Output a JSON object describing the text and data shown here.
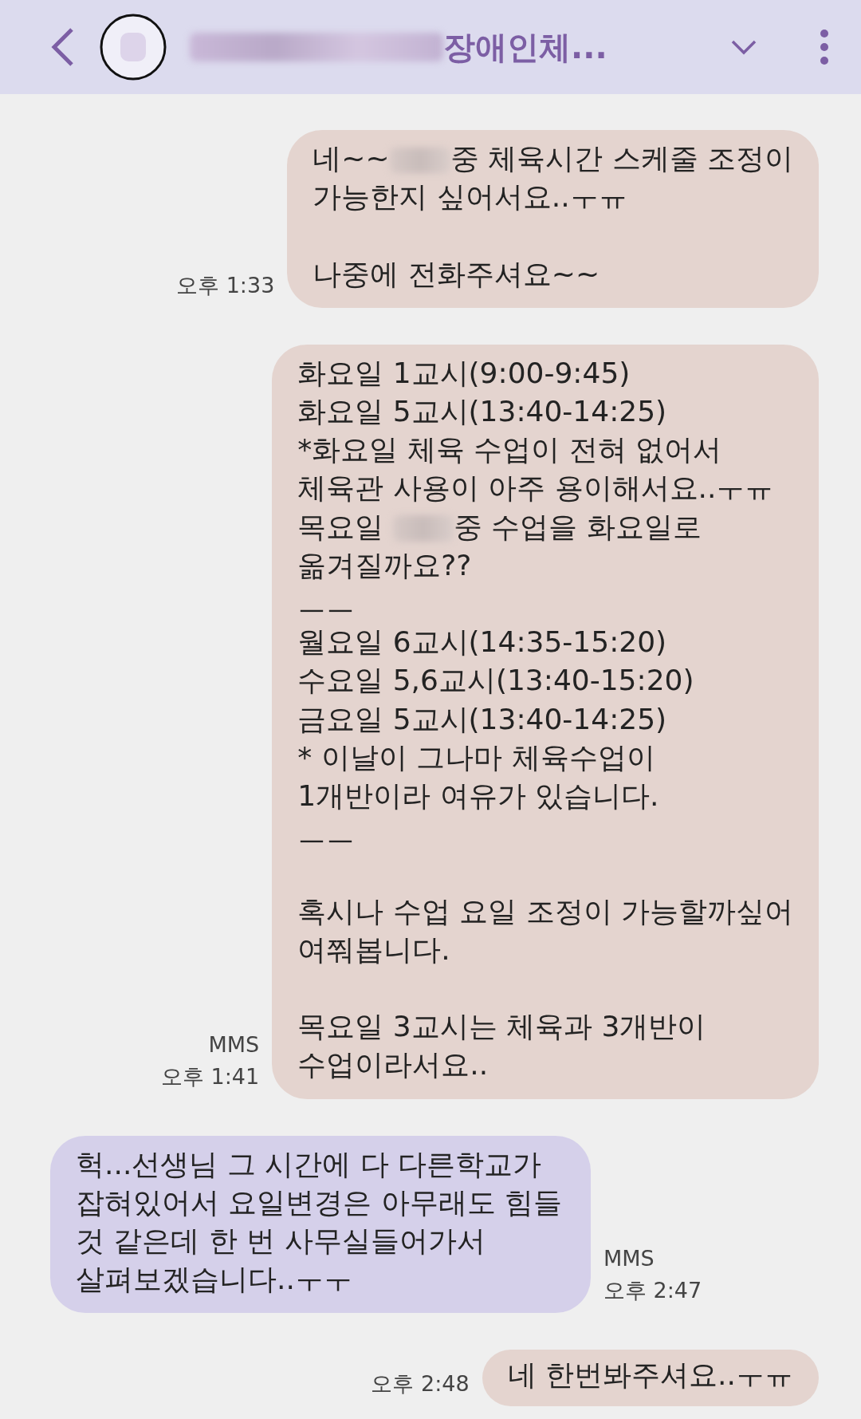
{
  "header": {
    "title": [
      {
        "kind": "redacted"
      },
      {
        "kind": "text",
        "text": "장애인체..."
      }
    ]
  },
  "messages": [
    {
      "kind": "sent",
      "time": "오후 1:33",
      "lines": [
        [
          {
            "kind": "text",
            "text": "네~~"
          },
          {
            "kind": "redacted"
          },
          {
            "kind": "text",
            "text": "중 체육시간 스케줄 조정이"
          }
        ],
        [
          {
            "kind": "text",
            "text": "가능한지 싶어서요..ㅜㅠ"
          }
        ],
        [
          {
            "kind": "blank"
          }
        ],
        [
          {
            "kind": "text",
            "text": "나중에 전화주셔요~~"
          }
        ]
      ]
    },
    {
      "kind": "sent",
      "meta": [
        "MMS"
      ],
      "time": "오후 1:41",
      "lines": [
        [
          {
            "kind": "text",
            "text": "화요일 1교시(9:00-9:45)"
          }
        ],
        [
          {
            "kind": "text",
            "text": "화요일 5교시(13:40-14:25)"
          }
        ],
        [
          {
            "kind": "text",
            "text": "*화요일 체육 수업이 전혀 없어서"
          }
        ],
        [
          {
            "kind": "text",
            "text": "체육관 사용이 아주 용이해서요..ㅜㅠ"
          }
        ],
        [
          {
            "kind": "text",
            "text": "목요일 "
          },
          {
            "kind": "redacted"
          },
          {
            "kind": "text",
            "text": "중 수업을 화요일로"
          }
        ],
        [
          {
            "kind": "text",
            "text": "옮겨질까요??"
          }
        ],
        [
          {
            "kind": "text",
            "text": "ㅡㅡ"
          }
        ],
        [
          {
            "kind": "text",
            "text": "월요일 6교시(14:35-15:20)"
          }
        ],
        [
          {
            "kind": "text",
            "text": "수요일 5,6교시(13:40-15:20)"
          }
        ],
        [
          {
            "kind": "text",
            "text": "금요일 5교시(13:40-14:25)"
          }
        ],
        [
          {
            "kind": "text",
            "text": "* 이날이 그나마 체육수업이"
          }
        ],
        [
          {
            "kind": "text",
            "text": "1개반이라 여유가 있습니다."
          }
        ],
        [
          {
            "kind": "text",
            "text": "ㅡㅡ"
          }
        ],
        [
          {
            "kind": "blank"
          }
        ],
        [
          {
            "kind": "text",
            "text": "혹시나 수업 요일 조정이 가능할까싶어"
          }
        ],
        [
          {
            "kind": "text",
            "text": "여쭤봅니다."
          }
        ],
        [
          {
            "kind": "blank"
          }
        ],
        [
          {
            "kind": "text",
            "text": "목요일 3교시는 체육과 3개반이"
          }
        ],
        [
          {
            "kind": "text",
            "text": "수업이라서요.."
          }
        ]
      ]
    },
    {
      "kind": "received",
      "meta": [
        "MMS"
      ],
      "time": "오후 2:47",
      "lines": [
        [
          {
            "kind": "text",
            "text": "헉...선생님 그 시간에 다 다른학교가"
          }
        ],
        [
          {
            "kind": "text",
            "text": "잡혀있어서 요일변경은 아무래도 힘들"
          }
        ],
        [
          {
            "kind": "text",
            "text": "것 같은데 한 번 사무실들어가서"
          }
        ],
        [
          {
            "kind": "text",
            "text": "살펴보겠습니다..ㅜㅜ"
          }
        ]
      ]
    },
    {
      "kind": "sent",
      "time": "오후 2:48",
      "lines": [
        [
          {
            "kind": "text",
            "text": "네 한번봐주셔요..ㅜㅠ"
          }
        ]
      ]
    }
  ]
}
